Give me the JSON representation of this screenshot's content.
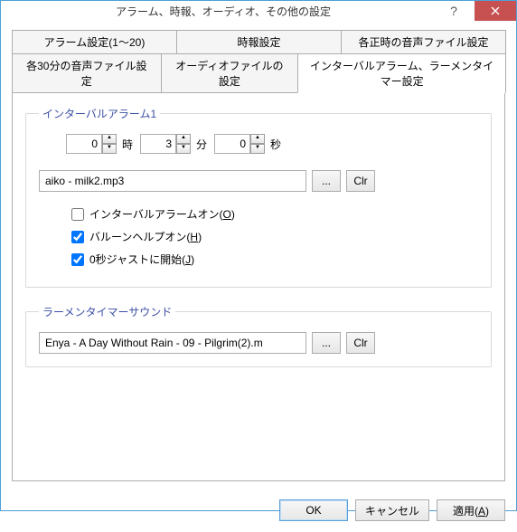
{
  "title": "アラーム、時報、オーディオ、その他の設定",
  "tabs_row1": [
    "アラーム設定(1～20)",
    "時報設定",
    "各正時の音声ファイル設定"
  ],
  "tabs_row2": [
    "各30分の音声ファイル設定",
    "オーディオファイルの設定",
    "インターバルアラーム、ラーメンタイマー設定"
  ],
  "group1": {
    "legend": "インターバルアラーム1",
    "hours": "0",
    "minutes": "3",
    "seconds": "0",
    "unit_h": "時",
    "unit_m": "分",
    "unit_s": "秒",
    "file": "aiko - milk2.mp3",
    "browse": "...",
    "clr": "Clr",
    "chk1": "インターバルアラームオン(",
    "chk1_key": "O",
    "chk1_end": ")",
    "chk2": "バルーンヘルプオン(",
    "chk2_key": "H",
    "chk2_end": ")",
    "chk3": "0秒ジャストに開始(",
    "chk3_key": "J",
    "chk3_end": ")"
  },
  "group2": {
    "legend": "ラーメンタイマーサウンド",
    "file": "Enya - A Day Without Rain - 09 - Pilgrim(2).m",
    "browse": "...",
    "clr": "Clr"
  },
  "buttons": {
    "ok": "OK",
    "cancel": "キャンセル",
    "apply_pre": "適用(",
    "apply_key": "A",
    "apply_end": ")"
  }
}
